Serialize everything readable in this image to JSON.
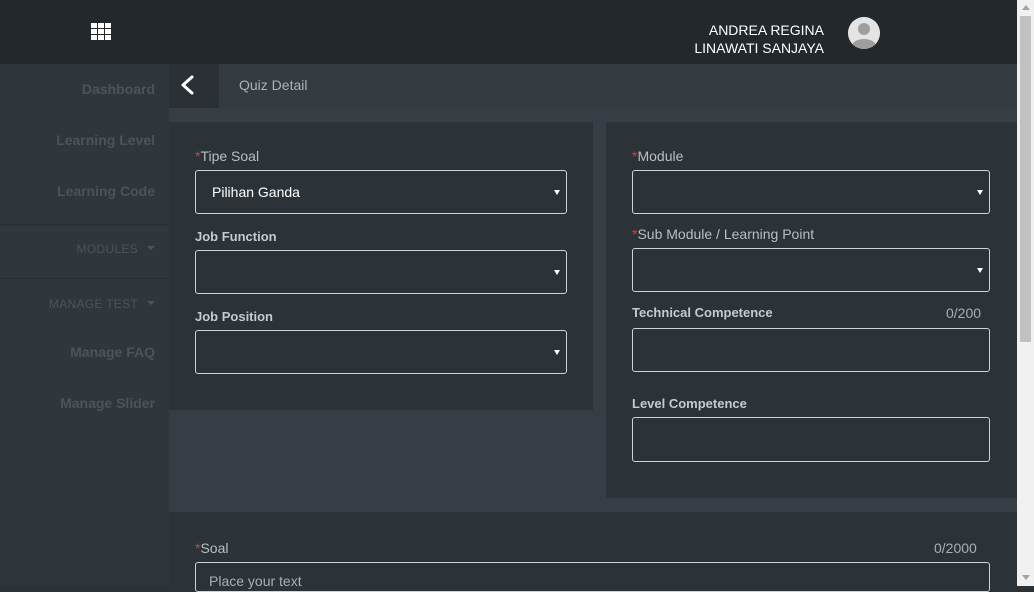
{
  "header": {
    "user_name_line1": "ANDREA REGINA",
    "user_name_line2": "LINAWATI SANJAYA"
  },
  "sidebar": {
    "items": [
      {
        "label": "Dashboard"
      },
      {
        "label": "Learning Level"
      },
      {
        "label": "Learning Code"
      },
      {
        "label": "MODULES"
      },
      {
        "label": "MANAGE TEST"
      },
      {
        "label": "Manage FAQ"
      },
      {
        "label": "Manage Slider"
      }
    ]
  },
  "breadcrumb": {
    "title": "Quiz Detail"
  },
  "form": {
    "required_mark": "*",
    "tipe_soal": {
      "label": "Tipe Soal",
      "value": "Pilihan Ganda"
    },
    "job_function": {
      "label": "Job Function",
      "value": ""
    },
    "job_position": {
      "label": "Job Position",
      "value": ""
    },
    "module": {
      "label": "Module",
      "value": ""
    },
    "sub_module": {
      "label": "Sub Module / Learning Point",
      "value": ""
    },
    "technical_competence": {
      "label": "Technical Competence",
      "counter": "0/200"
    },
    "level_competence": {
      "label": "Level Competence"
    },
    "soal": {
      "label": "Soal",
      "counter": "0/2000",
      "placeholder": "Place your text"
    }
  },
  "colors": {
    "required": "#e53935",
    "topbar": "#23282c",
    "sidebar": "#2f363c",
    "card": "#2c3338"
  }
}
